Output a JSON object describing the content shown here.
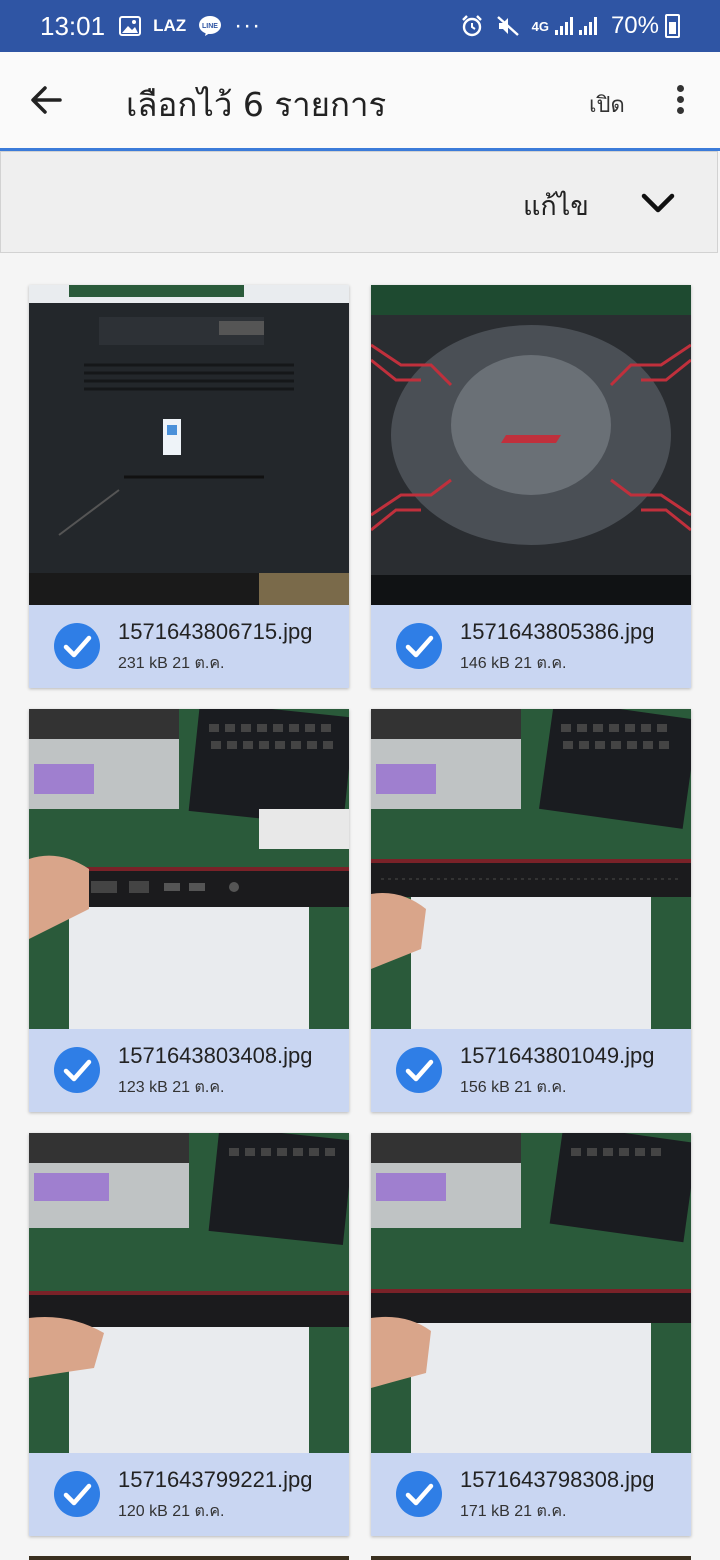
{
  "status_bar": {
    "time": "13:01",
    "left_icons": [
      "gallery-icon",
      "laz-icon",
      "line-icon",
      "more-dots-icon"
    ],
    "laz_label": "LAZ",
    "line_label": "LINE",
    "dots": "···",
    "network": "4G",
    "battery": "70%"
  },
  "app_bar": {
    "title": "เลือกไว้ 6 รายการ",
    "open_label": "เปิด"
  },
  "edit_bar": {
    "label": "แก้ไข"
  },
  "files": [
    {
      "name": "1571643806715.jpg",
      "meta": "231 kB 21 ต.ค.",
      "selected": true
    },
    {
      "name": "1571643805386.jpg",
      "meta": "146 kB 21 ต.ค.",
      "selected": true
    },
    {
      "name": "1571643803408.jpg",
      "meta": "123 kB 21 ต.ค.",
      "selected": true
    },
    {
      "name": "1571643801049.jpg",
      "meta": "156 kB 21 ต.ค.",
      "selected": true
    },
    {
      "name": "1571643799221.jpg",
      "meta": "120 kB 21 ต.ค.",
      "selected": true
    },
    {
      "name": "1571643798308.jpg",
      "meta": "171 kB 21 ต.ค.",
      "selected": true
    }
  ],
  "colors": {
    "status_bar": "#2f55a4",
    "accent": "#3b7bd9",
    "card_selected": "#c9d6f2",
    "check": "#2f7ee6"
  }
}
